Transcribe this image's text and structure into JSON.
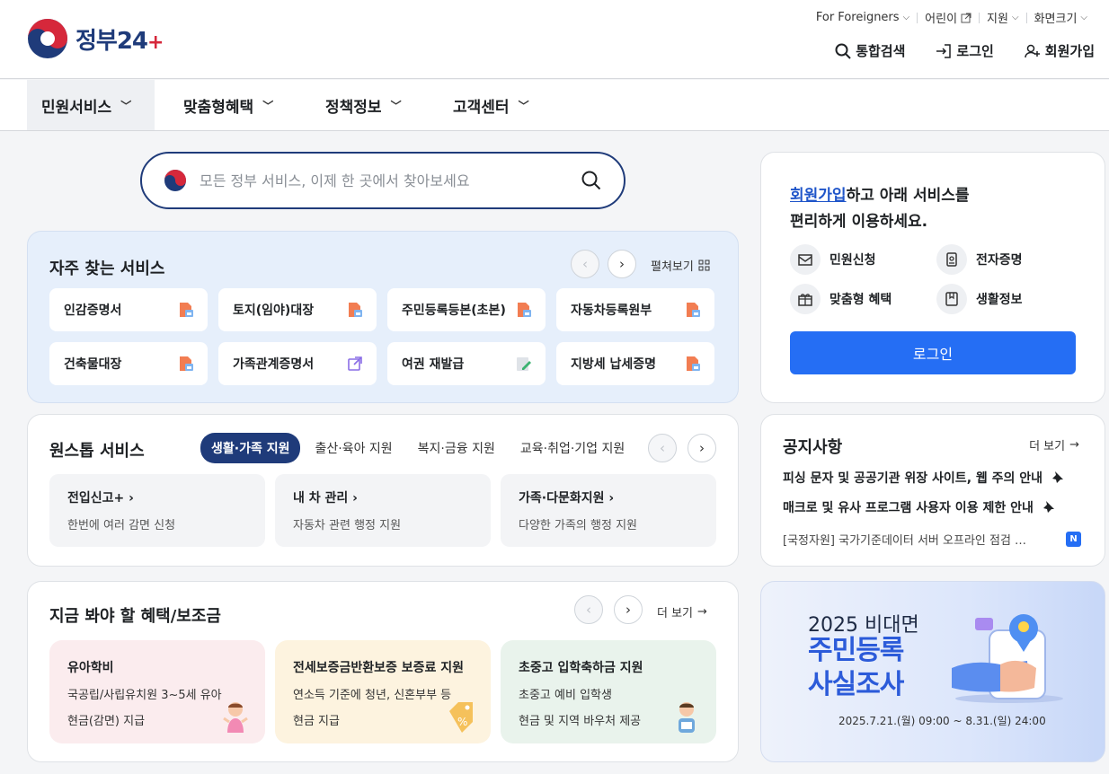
{
  "header": {
    "logo_text": "정부",
    "logo_num": "24",
    "util": [
      "For Foreigners",
      "어린이",
      "지원",
      "화면크기"
    ],
    "search_label": "통합검색",
    "login_label": "로그인",
    "join_label": "회원가입"
  },
  "gnb": [
    "민원서비스",
    "맞춤형혜택",
    "정책정보",
    "고객센터"
  ],
  "search": {
    "placeholder": "모든 정부 서비스, 이제 한 곳에서 찾아보세요"
  },
  "frequent": {
    "title": "자주 찾는 서비스",
    "expand_label": "펼쳐보기",
    "items": [
      {
        "label": "인감증명서",
        "icon": "document-print-icon"
      },
      {
        "label": "토지(임야)대장",
        "icon": "document-print-icon"
      },
      {
        "label": "주민등록등본(초본)",
        "icon": "document-print-icon"
      },
      {
        "label": "자동차등록원부",
        "icon": "document-print-icon"
      },
      {
        "label": "건축물대장",
        "icon": "document-print-icon"
      },
      {
        "label": "가족관계증명서",
        "icon": "external-link-icon"
      },
      {
        "label": "여권 재발급",
        "icon": "edit-document-icon"
      },
      {
        "label": "지방세 납세증명",
        "icon": "document-print-icon"
      }
    ]
  },
  "onestop": {
    "title": "원스톱 서비스",
    "tabs": [
      "생활·가족 지원",
      "출산·육아 지원",
      "복지·금융 지원",
      "교육·취업·기업 지원"
    ],
    "items": [
      {
        "title": "전입신고+",
        "desc": "한번에 여러 감면 신청"
      },
      {
        "title": "내 차 관리",
        "desc": "자동차 관련 행정 지원"
      },
      {
        "title": "가족·다문화지원",
        "desc": "다양한 가족의 행정 지원"
      }
    ]
  },
  "benefit": {
    "title": "지금 봐야 할 혜택/보조금",
    "more_label": "더 보기",
    "items": [
      {
        "title": "유아학비",
        "desc": "국공립/사립유치원 3~5세 유아",
        "meta": "현금(감면) 지급",
        "color": "#fbecee"
      },
      {
        "title": "전세보증금반환보증 보증료 지원",
        "desc": "연소득 기준에 청년, 신혼부부 등",
        "meta": "현금 지급",
        "color": "#fdf3df"
      },
      {
        "title": "초중고 입학축하금 지원",
        "desc": "초중고 예비 입학생",
        "meta": "현금 및 지역 바우처 제공",
        "color": "#e9f3ec"
      }
    ]
  },
  "join_card": {
    "msg_link": "회원가입",
    "msg_rest1": "하고 아래 서비스를",
    "msg_line2": "편리하게 이용하세요.",
    "features": [
      "민원신청",
      "전자증명",
      "맞춤형 혜택",
      "생활정보"
    ],
    "login_button": "로그인"
  },
  "notice": {
    "title": "공지사항",
    "more_label": "더 보기",
    "items": [
      "피싱 문자 및 공공기관 위장 사이트, 웹 주의 안내",
      "매크로 및 유사 프로그램 사용자 이용 제한 안내",
      "[국정자원] 국가기준데이터 서버 오프라인 점검 …"
    ],
    "new_badge": "N"
  },
  "banner": {
    "line1": "2025 비대면",
    "line2a": "주민등록",
    "line2b": "사실조사",
    "period": "2025.7.21.(월) 09:00 ~ 8.31.(일) 24:00"
  },
  "colors": {
    "primary": "#256ef4",
    "navy": "#1f3b7a",
    "accent_red": "#d6283b"
  }
}
